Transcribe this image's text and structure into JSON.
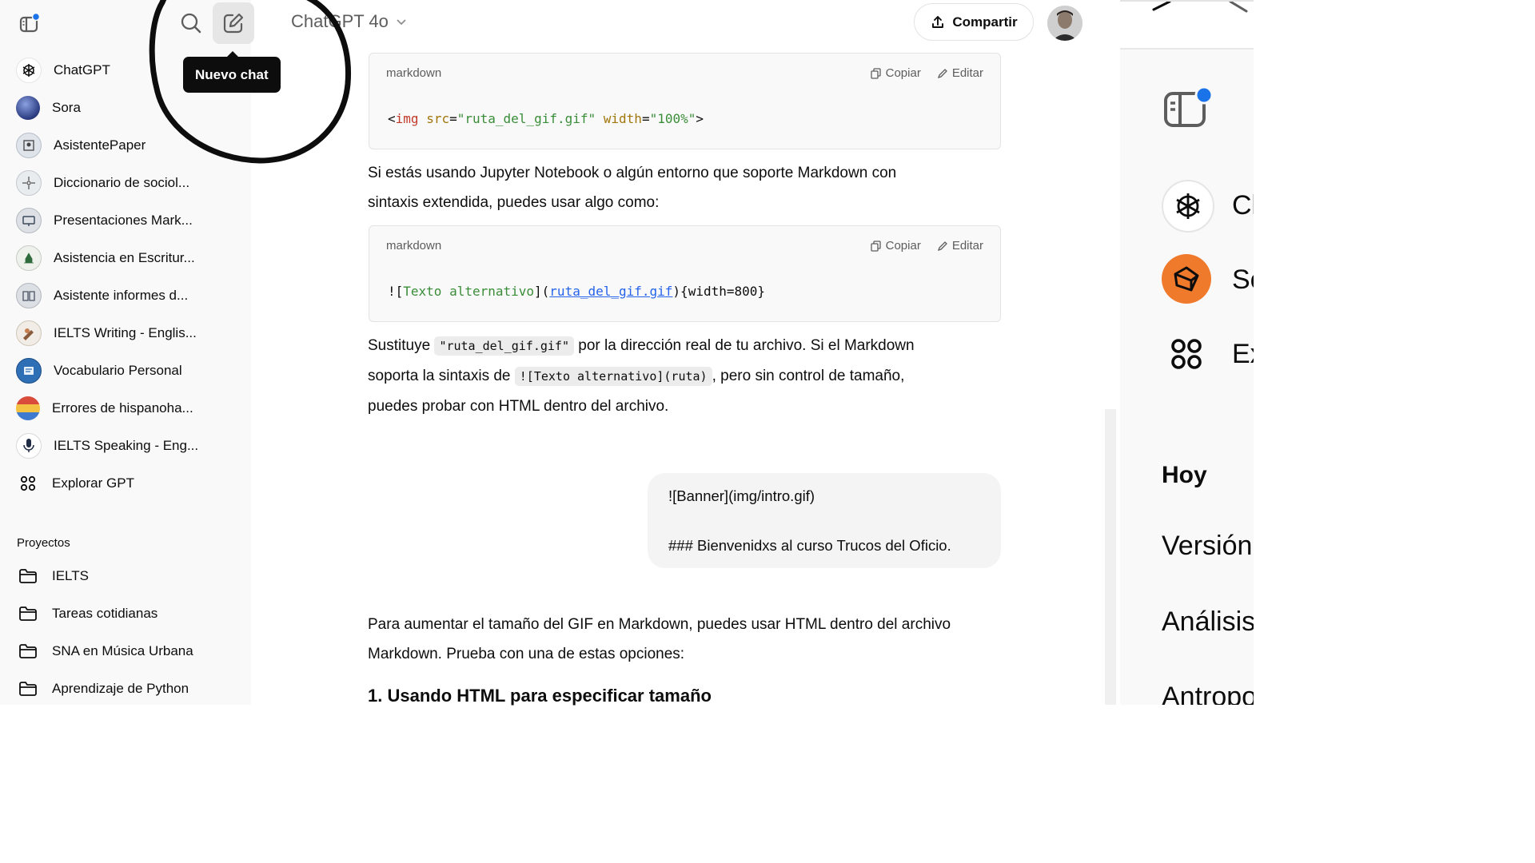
{
  "header": {
    "model_name": "ChatGPT 4o",
    "share_label": "Compartir"
  },
  "tooltip": "Nuevo chat",
  "sidebar": {
    "gpts": [
      {
        "label": "ChatGPT",
        "icon": "openai-logo-icon"
      },
      {
        "label": "Sora",
        "icon": "sora-avatar-icon"
      },
      {
        "label": "AsistentePaper",
        "icon": "gpt-avatar-icon"
      },
      {
        "label": "Diccionario de sociol...",
        "icon": "gpt-avatar-icon"
      },
      {
        "label": "Presentaciones Mark...",
        "icon": "gpt-avatar-icon"
      },
      {
        "label": "Asistencia en Escritur...",
        "icon": "gpt-avatar-icon"
      },
      {
        "label": "Asistente informes d...",
        "icon": "gpt-avatar-icon"
      },
      {
        "label": "IELTS Writing - Englis...",
        "icon": "gpt-avatar-icon"
      },
      {
        "label": "Vocabulario Personal",
        "icon": "gpt-avatar-icon"
      },
      {
        "label": "Errores de hispanoha...",
        "icon": "gpt-avatar-icon"
      },
      {
        "label": "IELTS Speaking - Eng...",
        "icon": "gpt-avatar-icon"
      },
      {
        "label": "Explorar GPT",
        "icon": "grid-icon"
      }
    ],
    "projects_title": "Proyectos",
    "projects": [
      {
        "label": "IELTS"
      },
      {
        "label": "Tareas cotidianas"
      },
      {
        "label": "SNA en Música Urbana"
      },
      {
        "label": "Aprendizaje de Python"
      }
    ]
  },
  "code_blocks": [
    {
      "lang": "markdown",
      "copy_label": "Copiar",
      "edit_label": "Editar",
      "line": {
        "lt": "<",
        "tag": "img",
        "sp1": " ",
        "attr1": "src",
        "eq1": "=",
        "val1": "\"ruta_del_gif.gif\"",
        "sp2": " ",
        "attr2": "width",
        "eq2": "=",
        "val2": "\"100%\"",
        "gt": ">"
      }
    },
    {
      "lang": "markdown",
      "copy_label": "Copiar",
      "edit_label": "Editar",
      "line": {
        "pre": "![",
        "alt": "Texto alternativo",
        "mid": "](",
        "url": "ruta_del_gif.gif",
        "post": "){width=800}"
      }
    }
  ],
  "message": {
    "para1_line1": "Si estás usando Jupyter Notebook o algún entorno que soporte Markdown con",
    "para1_line2": "sintaxis extendida, puedes usar algo como:",
    "para2_a": "Sustituye ",
    "para2_code1": "\"ruta_del_gif.gif\"",
    "para2_b": " por la dirección real de tu archivo. Si el Markdown",
    "para2_c": "soporta la sintaxis de ",
    "para2_code2": "![Texto alternativo](ruta)",
    "para2_d": ", pero sin control de tamaño,",
    "para2_e": "puedes probar con HTML dentro del archivo."
  },
  "user_bubble": {
    "line1": "![Banner](img/intro.gif)",
    "line2": "### Bienvenidxs al curso Trucos del Oficio."
  },
  "reply": {
    "line1": "Para aumentar el tamaño del GIF en Markdown, puedes usar HTML dentro del archivo",
    "line2": "Markdown. Prueba con una de estas opciones:",
    "heading": "1. Usando HTML para especificar tamaño"
  },
  "right_pane": {
    "items": [
      "Cl",
      "Sc",
      "Ex"
    ],
    "section_title": "Hoy",
    "history": [
      "Versión",
      "Análisis",
      "Antropo"
    ]
  },
  "colors": {
    "sidebar_bg": "#f9f9f9",
    "tooltip_bg": "#0d0d0d",
    "sora_orange": "#f07a2c",
    "notification_dot": "#1a73e8"
  }
}
